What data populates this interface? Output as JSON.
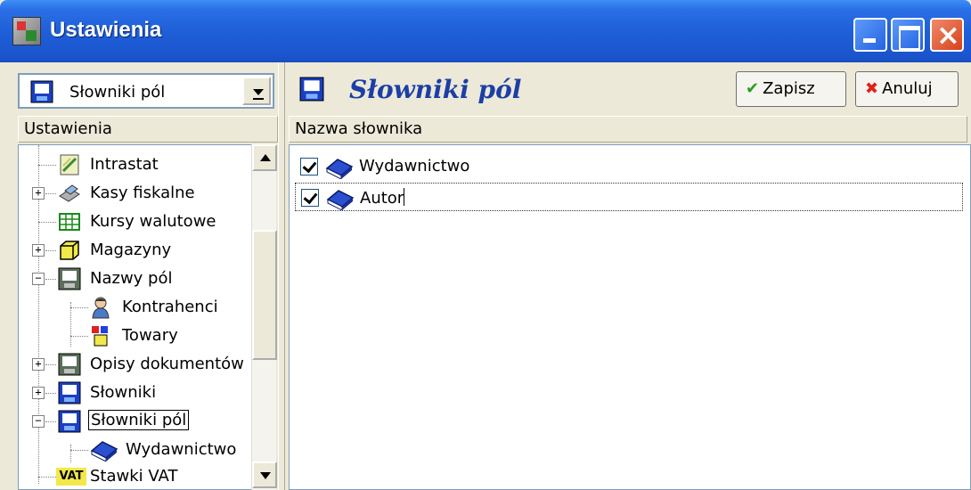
{
  "window": {
    "title": "Ustawienia"
  },
  "left": {
    "combo_value": "Słowniki pól",
    "header": "Ustawienia",
    "tree": [
      {
        "label": "Intrastat",
        "icon": "intrastat-icon"
      },
      {
        "label": "Kasy fiskalne",
        "icon": "cash-register-icon"
      },
      {
        "label": "Kursy walutowe",
        "icon": "currency-grid-icon"
      },
      {
        "label": "Magazyny",
        "icon": "warehouse-box-icon"
      },
      {
        "label": "Nazwy pól",
        "icon": "form-icon"
      },
      {
        "label": "Kontrahenci",
        "icon": "person-icon"
      },
      {
        "label": "Towary",
        "icon": "goods-icon"
      },
      {
        "label": "Opisy dokumentów",
        "icon": "form-icon"
      },
      {
        "label": "Słowniki",
        "icon": "dictionary-icon"
      },
      {
        "label": "Słowniki pól",
        "icon": "dictionary-icon"
      },
      {
        "label": "Wydawnictwo",
        "icon": "book-icon"
      },
      {
        "label": "Stawki VAT",
        "icon": "vat-icon"
      }
    ]
  },
  "right": {
    "title": "Słowniki pól",
    "save_label": "Zapisz",
    "cancel_label": "Anuluj",
    "column_header": "Nazwa słownika",
    "rows": [
      {
        "label": "Wydawnictwo",
        "checked": true
      },
      {
        "label": "Autor",
        "checked": true
      }
    ]
  },
  "colors": {
    "titlebar": "#1f5fd8",
    "accent_title": "#1c3fa6",
    "save_check": "#2a9d1f",
    "cancel_x": "#e0201b"
  }
}
